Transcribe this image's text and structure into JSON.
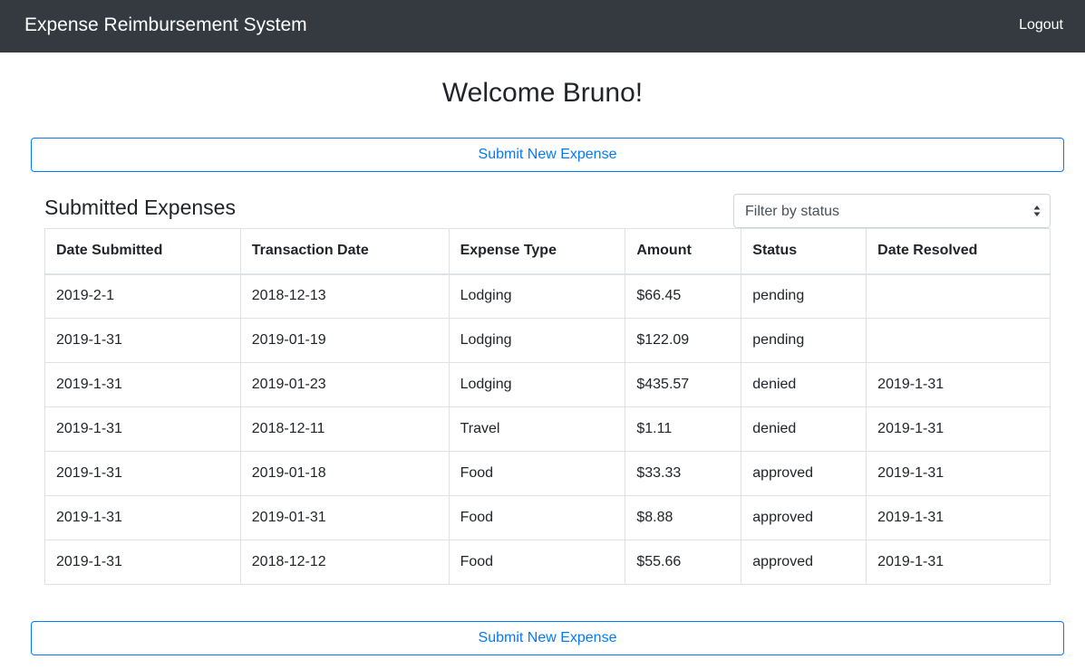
{
  "navbar": {
    "brand": "Expense Reimbursement System",
    "logout_label": "Logout"
  },
  "welcome": "Welcome Bruno!",
  "submit_button_label": "Submit New Expense",
  "section_title": "Submitted Expenses",
  "filter": {
    "placeholder": "Filter by status",
    "icon": "select-arrows-icon"
  },
  "table": {
    "columns": [
      "Date Submitted",
      "Transaction Date",
      "Expense Type",
      "Amount",
      "Status",
      "Date Resolved"
    ],
    "rows": [
      [
        "2019-2-1",
        "2018-12-13",
        "Lodging",
        "$66.45",
        "pending",
        ""
      ],
      [
        "2019-1-31",
        "2019-01-19",
        "Lodging",
        "$122.09",
        "pending",
        ""
      ],
      [
        "2019-1-31",
        "2019-01-23",
        "Lodging",
        "$435.57",
        "denied",
        "2019-1-31"
      ],
      [
        "2019-1-31",
        "2018-12-11",
        "Travel",
        "$1.11",
        "denied",
        "2019-1-31"
      ],
      [
        "2019-1-31",
        "2019-01-18",
        "Food",
        "$33.33",
        "approved",
        "2019-1-31"
      ],
      [
        "2019-1-31",
        "2019-01-31",
        "Food",
        "$8.88",
        "approved",
        "2019-1-31"
      ],
      [
        "2019-1-31",
        "2018-12-12",
        "Food",
        "$55.66",
        "approved",
        "2019-1-31"
      ]
    ]
  },
  "colors": {
    "navbar": "#343a40",
    "primary": "#007bff",
    "text": "#212529",
    "border": "#dee2e6"
  }
}
